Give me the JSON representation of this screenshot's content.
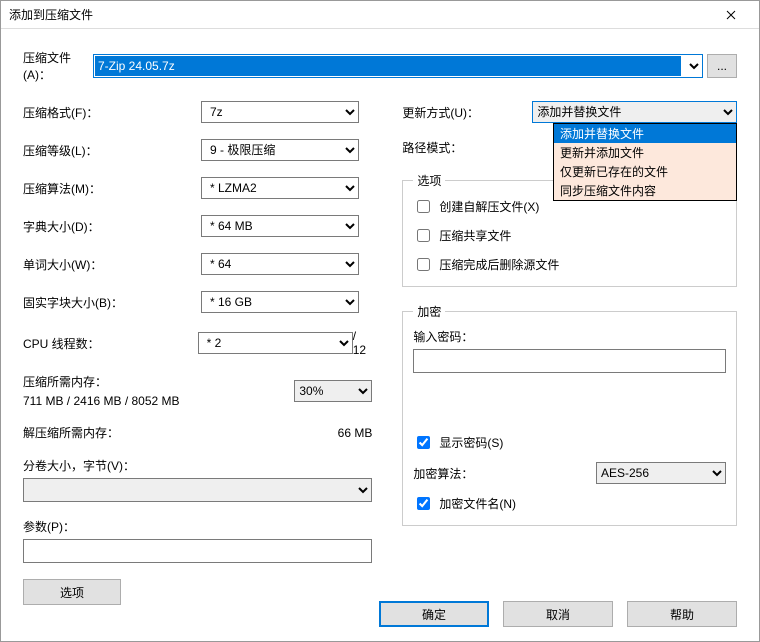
{
  "window": {
    "title": "添加到压缩文件"
  },
  "archive": {
    "label": "压缩文件(A)：",
    "value": "7-Zip 24.05.7z",
    "browse": "..."
  },
  "left": {
    "format": {
      "label": "压缩格式(F)：",
      "value": "7z"
    },
    "level": {
      "label": "压缩等级(L)：",
      "value": "9 - 极限压缩"
    },
    "method": {
      "label": "压缩算法(M)：",
      "value": "* LZMA2"
    },
    "dict": {
      "label": "字典大小(D)：",
      "value": "* 64 MB"
    },
    "word": {
      "label": "单词大小(W)：",
      "value": "* 64"
    },
    "solid": {
      "label": "固实字块大小(B)：",
      "value": "* 16 GB"
    },
    "threads": {
      "label": "CPU 线程数：",
      "value": "* 2",
      "total": "/ 12"
    },
    "mem_comp": {
      "label": "压缩所需内存：",
      "detail": "711 MB / 2416 MB / 8052 MB",
      "pct": "30%"
    },
    "mem_decomp": {
      "label": "解压缩所需内存：",
      "value": "66 MB"
    },
    "split": {
      "label": "分卷大小，字节(V)："
    },
    "params": {
      "label": "参数(P)："
    },
    "options_btn": "选项"
  },
  "right": {
    "update": {
      "label": "更新方式(U)：",
      "value": "添加并替换文件",
      "options": [
        "添加并替换文件",
        "更新并添加文件",
        "仅更新已存在的文件",
        "同步压缩文件内容"
      ]
    },
    "pathmode": {
      "label": "路径模式："
    },
    "options_legend": "选项",
    "sfx": "创建自解压文件(X)",
    "shared": "压缩共享文件",
    "delete": "压缩完成后删除源文件",
    "enc_legend": "加密",
    "pw_label": "输入密码：",
    "showpw": "显示密码(S)",
    "encalg": {
      "label": "加密算法：",
      "value": "AES-256"
    },
    "encnames": "加密文件名(N)"
  },
  "footer": {
    "ok": "确定",
    "cancel": "取消",
    "help": "帮助"
  }
}
